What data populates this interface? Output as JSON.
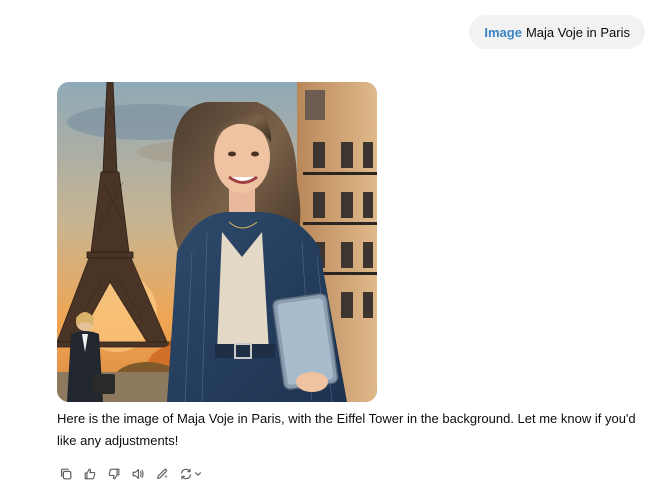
{
  "user_message": {
    "tag": "Image",
    "prompt": "Maja Voje in Paris"
  },
  "generated_image": {
    "subject": "Maja Voje in Paris"
  },
  "assistant_message": {
    "text": "Here is the image of Maja Voje in Paris, with the Eiffel Tower in the background. Let me know if you'd like any adjustments!"
  },
  "actions": {
    "icons": [
      "copy-icon",
      "thumbs-up-icon",
      "thumbs-down-icon",
      "read-aloud-icon",
      "edit-icon",
      "regenerate-icon",
      "chevron-down-icon"
    ]
  },
  "colors": {
    "tag": "#3b82c4",
    "bubble_bg": "#f2f2f2",
    "icon": "#5d5d5d"
  }
}
